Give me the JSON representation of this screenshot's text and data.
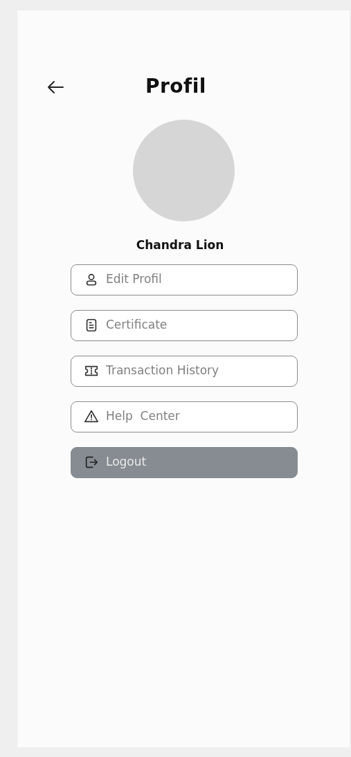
{
  "header": {
    "title": "Profil"
  },
  "profile": {
    "name": "Chandra Lion"
  },
  "menu": [
    {
      "label": "Edit Profil",
      "kind": "outline"
    },
    {
      "label": "Certificate",
      "kind": "outline"
    },
    {
      "label": "Transaction History",
      "kind": "outline"
    },
    {
      "label": "Help  Center",
      "kind": "outline"
    },
    {
      "label": "Logout",
      "kind": "filled"
    }
  ]
}
